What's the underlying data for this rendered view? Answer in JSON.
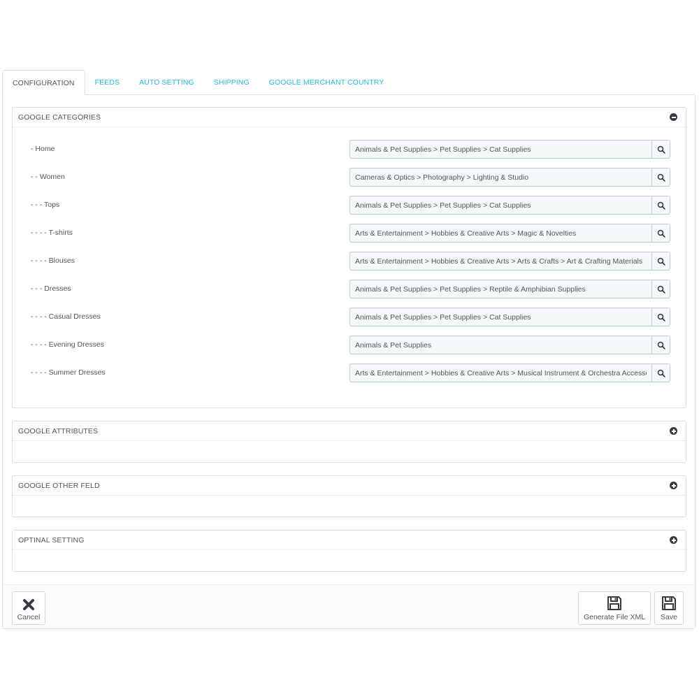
{
  "tabs": [
    {
      "label": "CONFIGURATION",
      "active": true
    },
    {
      "label": "FEEDS"
    },
    {
      "label": "AUTO SETTING"
    },
    {
      "label": "SHIPPING"
    },
    {
      "label": "GOOGLE MERCHANT COUNTRY"
    }
  ],
  "panels": {
    "categories": {
      "title": "GOOGLE CATEGORIES",
      "state": "expanded",
      "rows": [
        {
          "label": "- Home",
          "value": "Animals & Pet Supplies > Pet Supplies > Cat Supplies"
        },
        {
          "label": "- - Women",
          "value": "Cameras & Optics > Photography > Lighting & Studio"
        },
        {
          "label": "- - - Tops",
          "value": "Animals & Pet Supplies > Pet Supplies > Cat Supplies"
        },
        {
          "label": "- - - - T-shirts",
          "value": "Arts & Entertainment > Hobbies & Creative Arts > Magic & Novelties"
        },
        {
          "label": "- - - - Blouses",
          "value": "Arts & Entertainment > Hobbies & Creative Arts > Arts & Crafts > Art & Crafting Materials"
        },
        {
          "label": "- - - Dresses",
          "value": "Animals & Pet Supplies > Pet Supplies > Reptile & Amphibian Supplies"
        },
        {
          "label": "- - - - Casual Dresses",
          "value": "Animals & Pet Supplies > Pet Supplies > Cat Supplies"
        },
        {
          "label": "- - - - Evening Dresses",
          "value": "Animals & Pet Supplies"
        },
        {
          "label": "- - - - Summer Dresses",
          "value": "Arts & Entertainment > Hobbies & Creative Arts > Musical Instrument & Orchestra Accessories"
        }
      ]
    },
    "attributes": {
      "title": "GOOGLE ATTRIBUTES",
      "state": "collapsed"
    },
    "other": {
      "title": "GOOGLE OTHER FELD",
      "state": "collapsed"
    },
    "optional": {
      "title": "OPTINAL SETTING",
      "state": "collapsed"
    }
  },
  "footer": {
    "cancel_label": "Cancel",
    "generate_label": "Generate File XML",
    "save_label": "Save"
  },
  "colors": {
    "accent": "#25b9d7",
    "input_bg": "#f5f8f9",
    "input_border": "#bbcdd2",
    "icon_dark": "#363a41"
  }
}
